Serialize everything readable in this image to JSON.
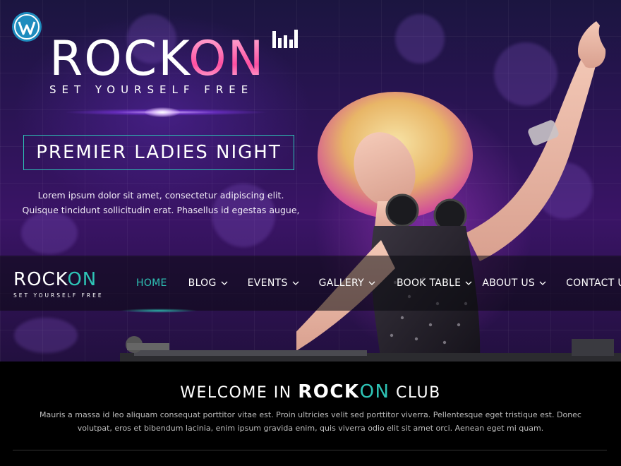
{
  "site": {
    "brand_prefix": "ROCK",
    "brand_suffix": "ON",
    "tagline": "SET YOURSELF FREE"
  },
  "hero": {
    "banner_title": "PREMIER LADIES NIGHT",
    "banner_text": "Lorem ipsum dolor sit amet, consectetur adipiscing elit. Quisque tincidunt sollicitudin erat. Phasellus id egestas augue,"
  },
  "nav": {
    "items": [
      {
        "label": "HOME",
        "active": true,
        "dropdown": false
      },
      {
        "label": "BLOG",
        "active": false,
        "dropdown": true
      },
      {
        "label": "EVENTS",
        "active": false,
        "dropdown": true
      },
      {
        "label": "GALLERY",
        "active": false,
        "dropdown": true
      },
      {
        "label": "BOOK TABLE",
        "active": false,
        "dropdown": true
      },
      {
        "label": "ABOUT US",
        "active": false,
        "dropdown": true
      },
      {
        "label": "CONTACT US",
        "active": false,
        "dropdown": false
      }
    ]
  },
  "welcome": {
    "title_pre": "WELCOME IN",
    "title_brand_a": "ROCK",
    "title_brand_b": "ON",
    "title_post": "CLUB",
    "text": "Mauris a massa id leo aliquam consequat porttitor vitae est. Proin ultricies velit sed porttitor viverra. Pellentesque eget tristique est. Donec volutpat, eros et bibendum lacinia, enim ipsum gravida enim, quis viverra odio elit sit amet orci. Aenean eget mi quam."
  },
  "icons": {
    "wordpress": "wordpress-icon",
    "equalizer": "equalizer-bars-icon",
    "dropdown": "chevron-down-icon"
  },
  "colors": {
    "accent": "#2ec4b6",
    "hero_purple": "#3a1466",
    "background": "#000000"
  }
}
